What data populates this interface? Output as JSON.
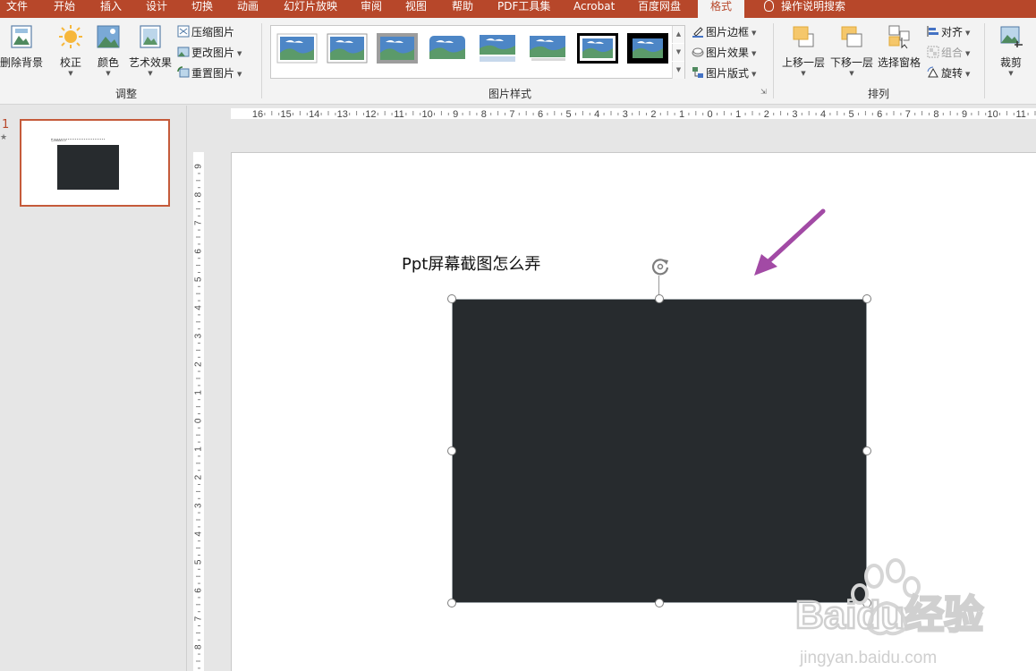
{
  "tabs": [
    {
      "label": "文件"
    },
    {
      "label": "开始"
    },
    {
      "label": "插入"
    },
    {
      "label": "设计"
    },
    {
      "label": "切换"
    },
    {
      "label": "动画"
    },
    {
      "label": "幻灯片放映"
    },
    {
      "label": "审阅"
    },
    {
      "label": "视图"
    },
    {
      "label": "帮助"
    },
    {
      "label": "PDF工具集"
    },
    {
      "label": "Acrobat"
    },
    {
      "label": "百度网盘"
    },
    {
      "label": "格式",
      "active": true
    }
  ],
  "tell_me": "操作说明搜索",
  "ribbon": {
    "adjust": {
      "remove_bg": "删除背景",
      "corrections": "校正",
      "color": "颜色",
      "artistic": "艺术效果",
      "compress": "压缩图片",
      "change": "更改图片",
      "reset": "重置图片",
      "group_label": "调整"
    },
    "styles": {
      "border": "图片边框",
      "effects": "图片效果",
      "layout": "图片版式",
      "group_label": "图片样式"
    },
    "arrange": {
      "bring_forward": "上移一层",
      "send_backward": "下移一层",
      "selection_pane": "选择窗格",
      "align": "对齐",
      "group": "组合",
      "rotate": "旋转",
      "group_label": "排列"
    },
    "size": {
      "crop": "裁剪"
    }
  },
  "thumbnails": [
    {
      "number": "1",
      "title": "Ppt屏幕截图怎么弄"
    }
  ],
  "ruler": {
    "horizontal": [
      "16",
      "15",
      "14",
      "13",
      "12",
      "11",
      "10",
      "9",
      "8",
      "7",
      "6",
      "5",
      "4",
      "3",
      "2",
      "1",
      "0",
      "1",
      "2",
      "3",
      "4",
      "5",
      "6",
      "7",
      "8",
      "9",
      "10",
      "11"
    ],
    "vertical": [
      "9",
      "8",
      "7",
      "6",
      "5",
      "4",
      "3",
      "2",
      "1",
      "0",
      "1",
      "2",
      "3",
      "4",
      "5",
      "6",
      "7",
      "8"
    ]
  },
  "slide": {
    "title": "Ppt屏幕截图怎么弄",
    "picture_color": "#272b2e",
    "arrow_color": "#a24aa5"
  },
  "watermark": {
    "brand": "Baidu经验",
    "url": "jingyan.baidu.com"
  },
  "colors": {
    "accent": "#b7472a",
    "ribbon_bg": "#f3f3f3"
  }
}
